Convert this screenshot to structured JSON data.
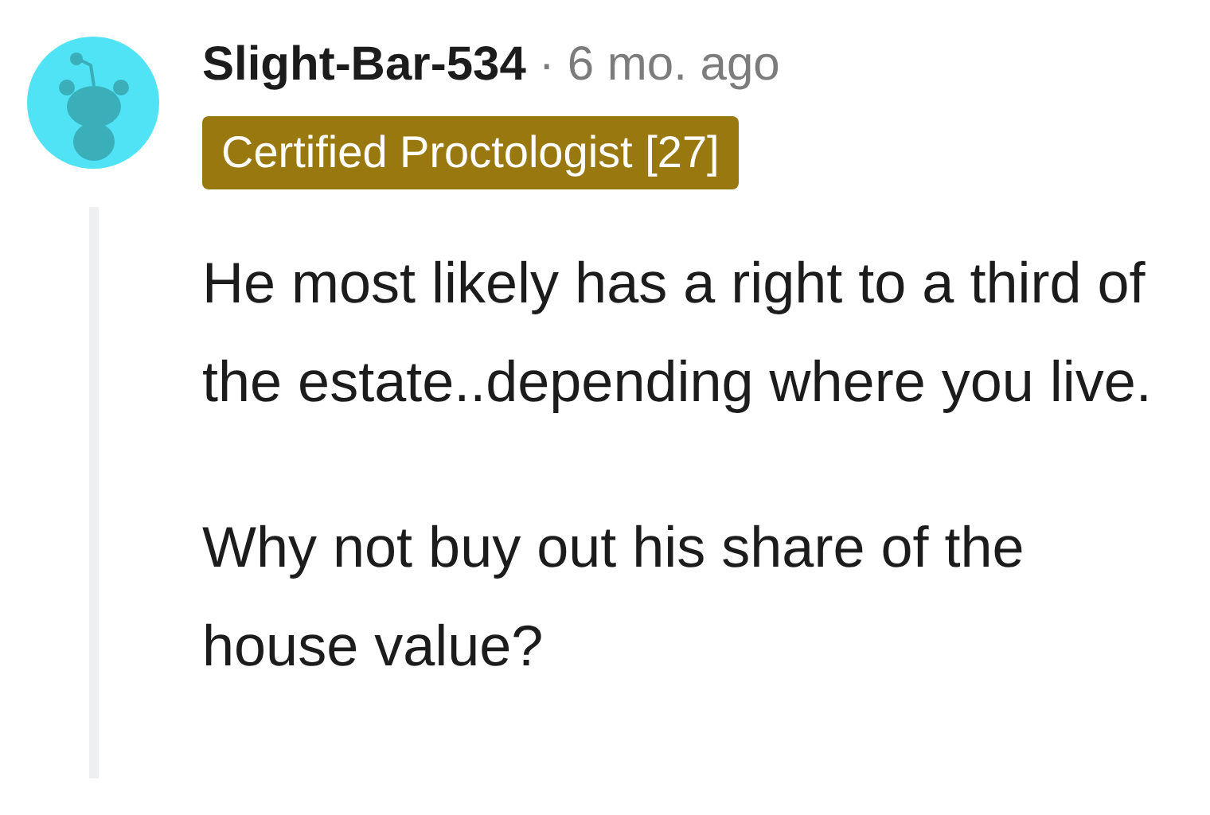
{
  "comment": {
    "author": "Slight-Bar-534",
    "separator": "·",
    "time": "6 mo. ago",
    "flair": "Certified Proctologist [27]",
    "paragraphs": [
      "He most likely has a right to a third of the estate..depending where you live.",
      "Why not buy out his share of the house value?"
    ]
  }
}
